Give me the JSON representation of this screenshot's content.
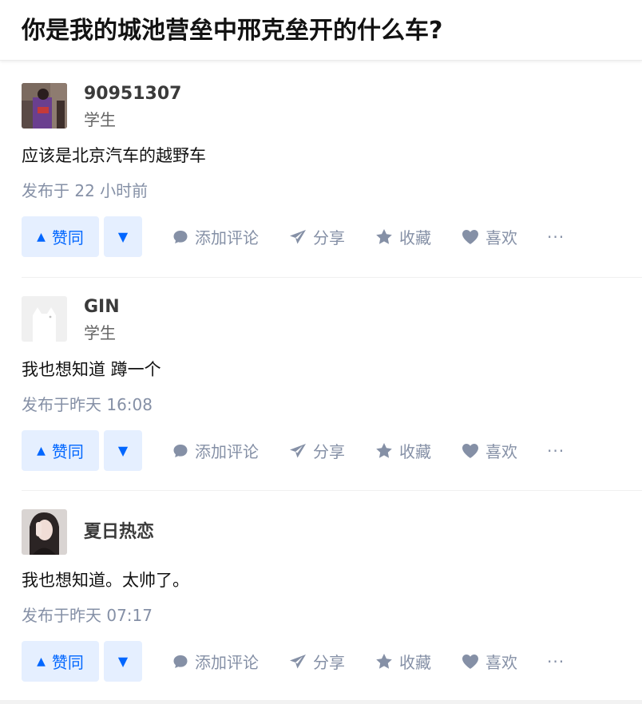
{
  "question": {
    "title": "你是我的城池营垒中邢克垒开的什么车?"
  },
  "actions": {
    "upvote_label": "赞同",
    "comment_label": "添加评论",
    "share_label": "分享",
    "collect_label": "收藏",
    "like_label": "喜欢",
    "more_label": "···"
  },
  "answers": [
    {
      "author_name": "90951307",
      "author_headline": "学生",
      "avatar": "avatar-photo-kimono",
      "content": "应该是北京汽车的越野车",
      "time": "发布于 22 小时前"
    },
    {
      "author_name": "GIN",
      "author_headline": "学生",
      "avatar": "avatar-default-cat",
      "content": "我也想知道 蹲一个",
      "time": "发布于昨天 16:08"
    },
    {
      "author_name": "夏日热恋",
      "author_headline": "",
      "avatar": "avatar-photo-woman",
      "content": "我也想知道。太帅了。",
      "time": "发布于昨天 07:17"
    }
  ],
  "colors": {
    "accent": "#0066ff",
    "accent_bg": "#e5efff",
    "meta": "#8590a6"
  }
}
